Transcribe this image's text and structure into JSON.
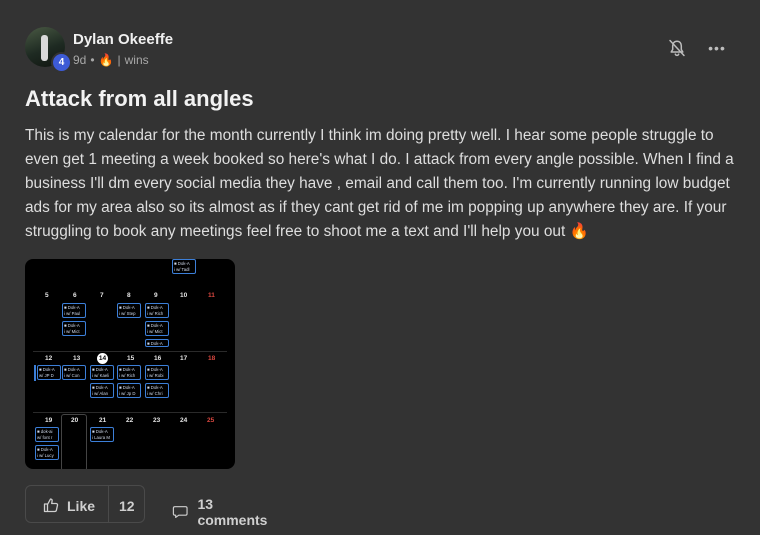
{
  "post": {
    "author": "Dylan Okeeffe",
    "level": "4",
    "age": "9d",
    "category": "wins",
    "title": "Attack from all angles",
    "body": "This is my calendar for the month currently I think im doing pretty well. I hear some people struggle to even get 1 meeting a week booked so here's what I do. I attack from every angle possible. When I find a business I'll dm every social media they have , email and call them too. I'm currently running low budget ads for my area also so its almost as if they cant get rid of me im popping up anywhere they are. If your struggling to book any meetings feel free to shoot me a text and I'll help you out 🔥"
  },
  "calendar": {
    "week1": [
      "5",
      "6",
      "7",
      "8",
      "9",
      "10",
      "11"
    ],
    "week2": [
      "12",
      "13",
      "14",
      "15",
      "16",
      "17",
      "18"
    ],
    "week3": [
      "19",
      "20",
      "21",
      "22",
      "23",
      "24",
      "25"
    ],
    "events": [
      {
        "t1": "■ Dok-A",
        "t2": "i w/ Tadl"
      },
      {
        "t1": "■ Dok-A",
        "t2": "i w/ Paul"
      },
      {
        "t1": "■ Dok-A",
        "t2": "i w/ Mict"
      },
      {
        "t1": "■ Dok-A",
        "t2": "i w/ Step"
      },
      {
        "t1": "■ Dok-A",
        "t2": "i w/ Rich"
      },
      {
        "t1": "■ Dok-A",
        "t2": "i w/ Mict"
      },
      {
        "t1": "■ Dok-A",
        "t2": ""
      },
      {
        "t1": "■ Dok-A",
        "t2": "w/ JP D"
      },
      {
        "t1": "■ Dok-A",
        "t2": "i w/ Con"
      },
      {
        "t1": "■ Dok-A",
        "t2": "i w/ Kaeli"
      },
      {
        "t1": "■ Dok-A",
        "t2": "i w/ Rich"
      },
      {
        "t1": "■ Dok-A",
        "t2": "i w/ Robi"
      },
      {
        "t1": "■ Dok-A",
        "t2": "i w/ Alan"
      },
      {
        "t1": "■ Dok-A",
        "t2": "i w/ Jp D"
      },
      {
        "t1": "■ Dok-A",
        "t2": "i w/ Chri"
      },
      {
        "t1": "■ dok-ai",
        "t2": "w/ font r"
      },
      {
        "t1": "■ Dok-A",
        "t2": "i w/ Lucy"
      },
      {
        "t1": "■ Dok-A",
        "t2": "i Laura M"
      }
    ]
  },
  "actions": {
    "like_label": "Like",
    "like_count": "12",
    "comments_label": "13 comments"
  },
  "colors": {
    "background": "#333333",
    "level_badge": "#3d5bd6",
    "event_border": "#3c7fd8",
    "weekend_red": "#d9473f"
  },
  "icons": [
    "bell-off-icon",
    "more-options-icon",
    "fire-icon",
    "thumbs-up-icon",
    "comment-icon"
  ]
}
